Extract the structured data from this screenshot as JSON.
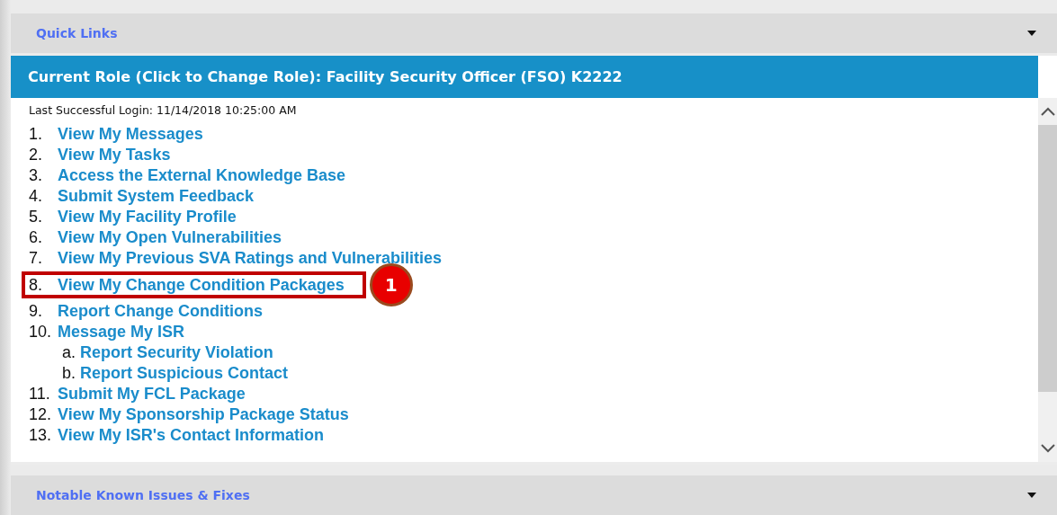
{
  "sections": [
    {
      "title": "Quick Links"
    },
    {
      "title": "Notable Known Issues & Fixes"
    }
  ],
  "role_bar": {
    "text": "Current Role (Click to Change Role): Facility Security Officer (FSO) K2222"
  },
  "last_login": "Last Successful Login: 11/14/2018 10:25:00 AM",
  "links": [
    {
      "number": "1.",
      "text": "View My Messages",
      "highlighted": false
    },
    {
      "number": "2.",
      "text": "View My Tasks",
      "highlighted": false
    },
    {
      "number": "3.",
      "text": "Access the External Knowledge Base",
      "highlighted": false
    },
    {
      "number": "4.",
      "text": "Submit System Feedback",
      "highlighted": false
    },
    {
      "number": "5.",
      "text": "View My Facility Profile",
      "highlighted": false
    },
    {
      "number": "6.",
      "text": "View My Open Vulnerabilities",
      "highlighted": false
    },
    {
      "number": "7.",
      "text": "View My Previous SVA Ratings and Vulnerabilities",
      "highlighted": false
    },
    {
      "number": "8.",
      "text": "View My Change Condition Packages",
      "highlighted": true,
      "callout": "1"
    },
    {
      "number": "9.",
      "text": "Report Change Conditions",
      "highlighted": false
    },
    {
      "number": "10.",
      "text": "Message My ISR",
      "highlighted": false,
      "children": [
        {
          "number": "a.",
          "text": "Report Security Violation",
          "highlighted": false
        },
        {
          "number": "b.",
          "text": "Report Suspicious Contact",
          "highlighted": false
        }
      ]
    },
    {
      "number": "11.",
      "text": "Submit My FCL Package",
      "highlighted": false
    },
    {
      "number": "12.",
      "text": "View My Sponsorship Package Status",
      "highlighted": false
    },
    {
      "number": "13.",
      "text": "View My ISR's Contact Information",
      "highlighted": false
    }
  ]
}
